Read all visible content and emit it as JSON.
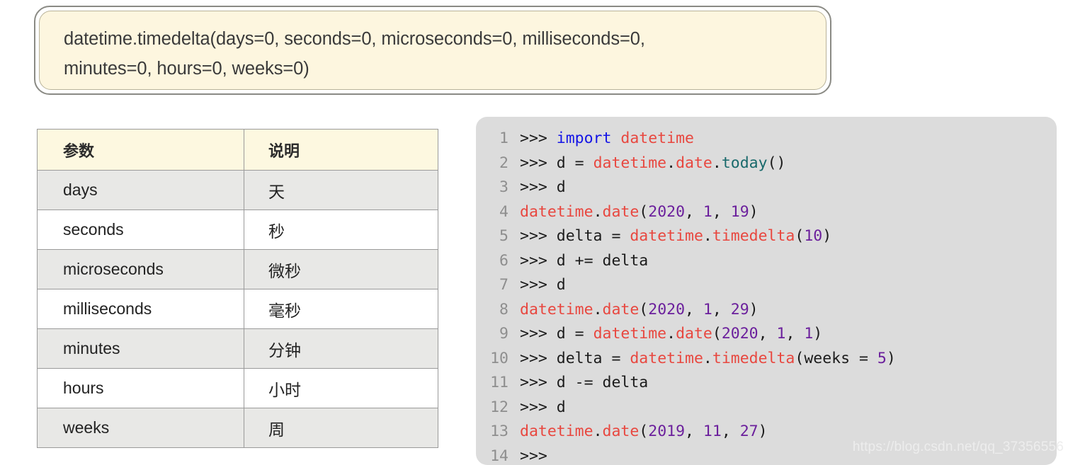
{
  "signature": {
    "text": "datetime.timedelta(days=0, seconds=0, microseconds=0, milliseconds=0,\nminutes=0, hours=0, weeks=0)",
    "bg_color": "#fdf6df",
    "border_color": "#8a8a84"
  },
  "param_table": {
    "headers": [
      "参数",
      "说明"
    ],
    "header_bg": "#fdf8e0",
    "alt_row_bg": "#e8e8e6",
    "rows": [
      {
        "name": "days",
        "desc": "天"
      },
      {
        "name": "seconds",
        "desc": "秒"
      },
      {
        "name": "microseconds",
        "desc": "微秒"
      },
      {
        "name": "milliseconds",
        "desc": "毫秒"
      },
      {
        "name": "minutes",
        "desc": "分钟"
      },
      {
        "name": "hours",
        "desc": "小时"
      },
      {
        "name": "weeks",
        "desc": "周"
      }
    ]
  },
  "code_panel": {
    "bg_color": "#dcdcdc",
    "prompt": ">>>",
    "colors": {
      "keyword": "#1414e6",
      "module": "#e8473f",
      "function": "#18696b",
      "number": "#6b1f9c",
      "plain": "#1b1b1b",
      "line_number": "#8e8e8e"
    },
    "lines": [
      {
        "n": "1",
        "text": ">>> import datetime"
      },
      {
        "n": "2",
        "text": ">>> d = datetime.date.today()"
      },
      {
        "n": "3",
        "text": ">>> d"
      },
      {
        "n": "4",
        "text": "datetime.date(2020, 1, 19)"
      },
      {
        "n": "5",
        "text": ">>> delta = datetime.timedelta(10)"
      },
      {
        "n": "6",
        "text": ">>> d += delta"
      },
      {
        "n": "7",
        "text": ">>> d"
      },
      {
        "n": "8",
        "text": "datetime.date(2020, 1, 29)"
      },
      {
        "n": "9",
        "text": ">>> d = datetime.date(2020, 1, 1)"
      },
      {
        "n": "10",
        "text": ">>> delta = datetime.timedelta(weeks = 5)"
      },
      {
        "n": "11",
        "text": ">>> d -= delta"
      },
      {
        "n": "12",
        "text": ">>> d"
      },
      {
        "n": "13",
        "text": "datetime.date(2019, 11, 27)"
      },
      {
        "n": "14",
        "text": ">>>"
      }
    ]
  },
  "watermark": {
    "text": "https://blog.csdn.net/qq_37356556"
  }
}
